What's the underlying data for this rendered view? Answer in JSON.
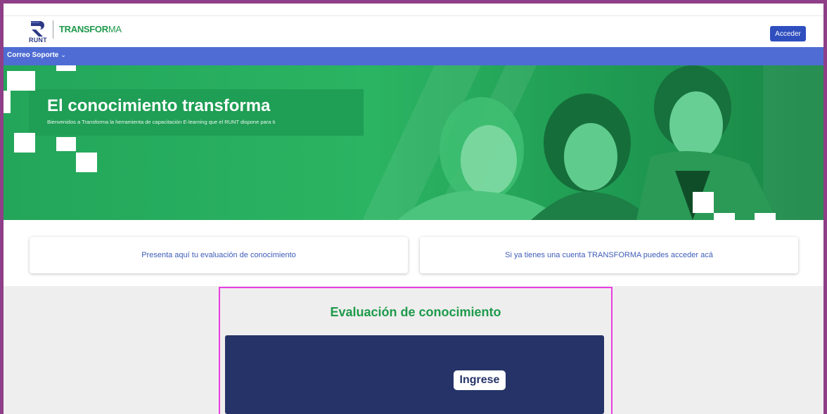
{
  "header": {
    "logo_text": "RUNT",
    "brand_bold": "TRANSFOR",
    "brand_light": "MA",
    "login_label": "Acceder"
  },
  "nav": {
    "items": [
      {
        "label": "Correo Soporte",
        "icon": "chevron-down-icon"
      }
    ]
  },
  "hero": {
    "title": "El conocimiento transforma",
    "subtitle": "Bienvenidos a Transforma la herramienta de capacitación E-learning que el RUNT dispone para ti"
  },
  "cards": [
    {
      "label": "Presenta aquí tu evaluación de conocimiento"
    },
    {
      "label": "Si ya tienes una cuenta TRANSFORMA puedes acceder acá"
    }
  ],
  "evaluation": {
    "title": "Evaluación de conocimiento",
    "button_label": "Ingrese"
  },
  "colors": {
    "brand_green": "#1e9a4b",
    "nav_blue": "#4e6cd3",
    "login_blue": "#2f4fbf",
    "panel_navy": "#253368",
    "highlight_magenta": "#e83ee0",
    "frame_purple": "#8e3f87"
  }
}
